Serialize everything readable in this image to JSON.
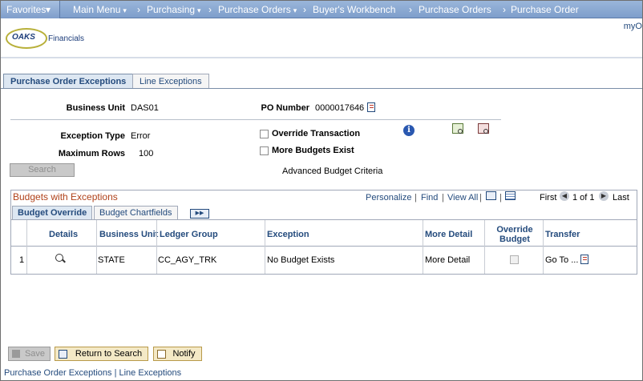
{
  "nav": {
    "favorites": "Favorites",
    "main_menu": "Main Menu",
    "breadcrumbs": [
      "Purchasing",
      "Purchase Orders",
      "Buyer's Workbench",
      "Purchase Orders",
      "Purchase Order"
    ]
  },
  "header": {
    "logo_text": "OAKS",
    "logo_sub": "Financials",
    "my_link": "myO"
  },
  "tabs": [
    {
      "label": "Purchase Order Exceptions",
      "active": true
    },
    {
      "label": "Line Exceptions",
      "active": false
    }
  ],
  "form": {
    "business_unit_label": "Business Unit",
    "business_unit_value": "DAS01",
    "po_number_label": "PO Number",
    "po_number_value": "0000017646",
    "exception_type_label": "Exception Type",
    "exception_type_value": "Error",
    "max_rows_label": "Maximum Rows",
    "max_rows_value": "100",
    "override_transaction_label": "Override Transaction",
    "more_budgets_label": "More Budgets Exist",
    "search_button": "Search",
    "advanced_budget_criteria": "Advanced Budget Criteria"
  },
  "grid": {
    "title": "Budgets with Exceptions",
    "personalize": "Personalize",
    "find": "Find",
    "view_all": "View All",
    "first": "First",
    "range": "1 of 1",
    "last": "Last",
    "tabs": [
      {
        "label": "Budget Override",
        "active": true
      },
      {
        "label": "Budget Chartfields",
        "active": false
      }
    ],
    "headers": {
      "details": "Details",
      "business_unit": "Business Unit",
      "ledger_group": "Ledger Group",
      "exception": "Exception",
      "more_detail": "More Detail",
      "override_budget_1": "Override",
      "override_budget_2": "Budget",
      "transfer": "Transfer"
    },
    "rows": [
      {
        "num": "1",
        "business_unit": "STATE",
        "ledger_group": "CC_AGY_TRK",
        "exception": "No Budget Exists",
        "more_detail": "More Detail",
        "override_budget": false,
        "transfer": "Go To ..."
      }
    ]
  },
  "buttons": {
    "save": "Save",
    "return_to_search": "Return to Search",
    "notify": "Notify"
  },
  "footer": {
    "link1": "Purchase Order Exceptions",
    "separator": "|",
    "link2": "Line Exceptions"
  }
}
